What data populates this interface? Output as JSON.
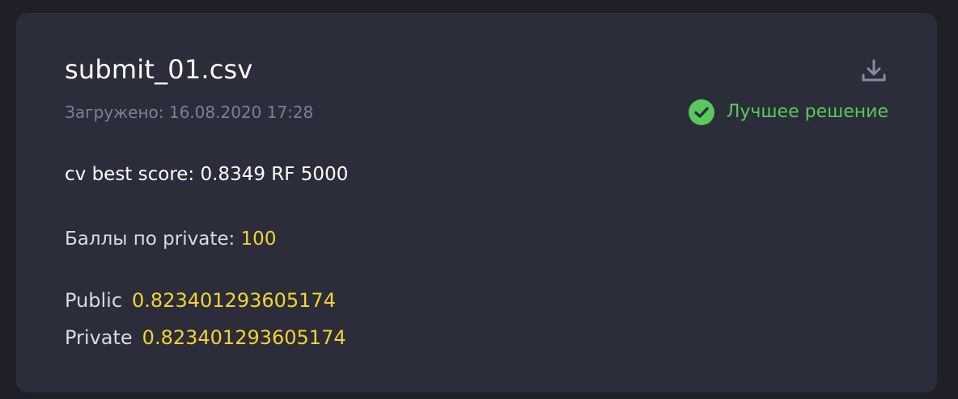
{
  "submission": {
    "filename": "submit_01.csv",
    "uploaded_label": "Загружено:",
    "uploaded_date": "16.08.2020 17:28",
    "best_label": "Лучшее решение",
    "comment": "cv best score: 0.8349 RF 5000",
    "points_label": "Баллы по private:",
    "points_value": "100",
    "public_label": "Public",
    "public_value": "0.823401293605174",
    "private_label": "Private",
    "private_value": "0.823401293605174"
  },
  "icons": {
    "download": "download-icon",
    "best": "check-circle-icon"
  },
  "colors": {
    "background": "#1e1f27",
    "card": "#2b2d3a",
    "accent_yellow": "#f3d233",
    "success_green": "#5ac85a",
    "muted_text": "#7d8094"
  }
}
